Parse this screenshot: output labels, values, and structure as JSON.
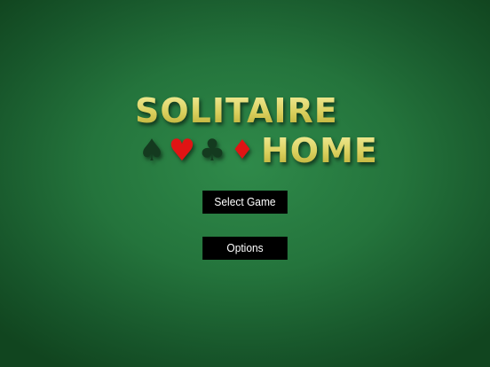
{
  "title": {
    "line1": "SOLITAIRE",
    "line2": "HOME",
    "suits": [
      {
        "icon": "spade-icon",
        "glyph": "♠",
        "color": "#143a1f"
      },
      {
        "icon": "heart-icon",
        "glyph": "♥",
        "color": "#e01414"
      },
      {
        "icon": "club-icon",
        "glyph": "♣",
        "color": "#143a1f"
      },
      {
        "icon": "diamond-icon",
        "glyph": "♦",
        "color": "#e01414"
      }
    ]
  },
  "menu": {
    "select_game_label": "Select Game",
    "options_label": "Options"
  },
  "colors": {
    "background": "#24743c",
    "title_gold": "#ddd36a",
    "button_bg": "#000000",
    "button_text": "#ffffff"
  }
}
